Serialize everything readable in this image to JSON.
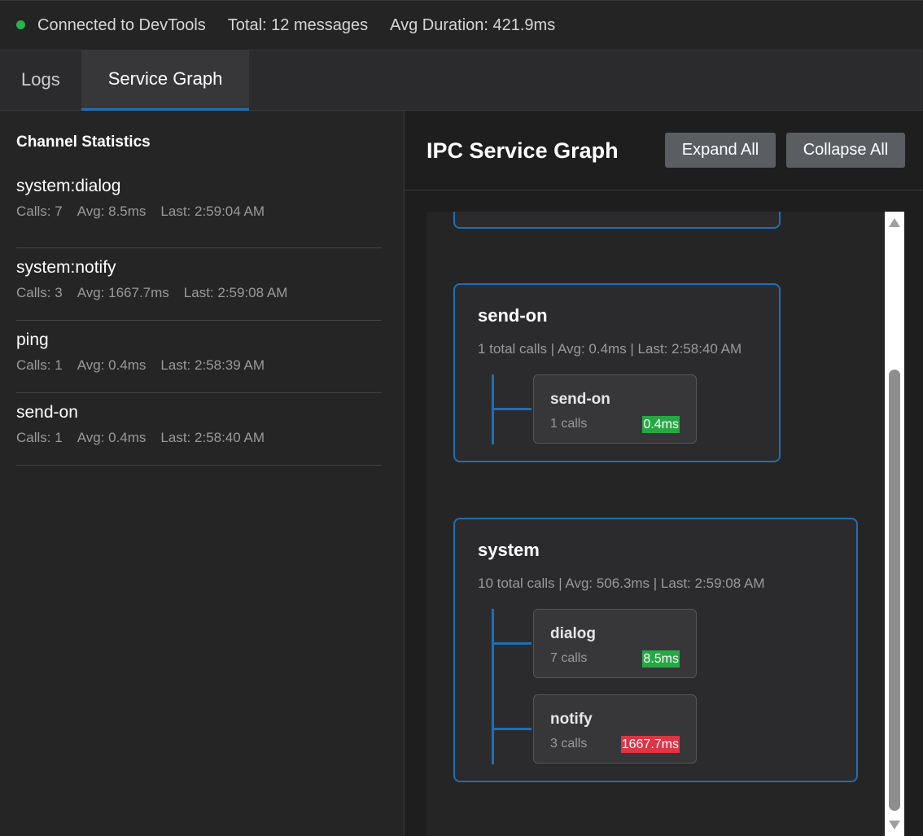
{
  "status": {
    "connection": "Connected to DevTools",
    "total": "Total: 12 messages",
    "avg_duration": "Avg Duration: 421.9ms",
    "dot_color": "#2bb24c"
  },
  "tabs": [
    {
      "label": "Logs",
      "active": false
    },
    {
      "label": "Service Graph",
      "active": true
    }
  ],
  "channel_stats": {
    "heading": "Channel Statistics",
    "items": [
      {
        "name": "system:dialog",
        "calls": "Calls: 7",
        "avg": "Avg: 8.5ms",
        "last": "Last: 2:59:04 AM"
      },
      {
        "name": "system:notify",
        "calls": "Calls: 3",
        "avg": "Avg: 1667.7ms",
        "last": "Last: 2:59:08 AM"
      },
      {
        "name": "ping",
        "calls": "Calls: 1",
        "avg": "Avg: 0.4ms",
        "last": "Last: 2:58:39 AM"
      },
      {
        "name": "send-on",
        "calls": "Calls: 1",
        "avg": "Avg: 0.4ms",
        "last": "Last: 2:58:40 AM"
      }
    ]
  },
  "graph": {
    "title": "IPC Service Graph",
    "expand_label": "Expand All",
    "collapse_label": "Collapse All",
    "services": [
      {
        "name": "send-on",
        "meta": "1 total calls | Avg: 0.4ms | Last: 2:58:40 AM",
        "nodes": [
          {
            "name": "send-on",
            "calls": "1 calls",
            "duration": "0.4ms",
            "status": "fast"
          }
        ]
      },
      {
        "name": "system",
        "meta": "10 total calls | Avg: 506.3ms | Last: 2:59:08 AM",
        "nodes": [
          {
            "name": "dialog",
            "calls": "7 calls",
            "duration": "8.5ms",
            "status": "fast"
          },
          {
            "name": "notify",
            "calls": "3 calls",
            "duration": "1667.7ms",
            "status": "slow"
          }
        ]
      }
    ]
  },
  "colors": {
    "accent": "#1f6fb5",
    "fast": "#28a745",
    "slow": "#dc3545"
  }
}
